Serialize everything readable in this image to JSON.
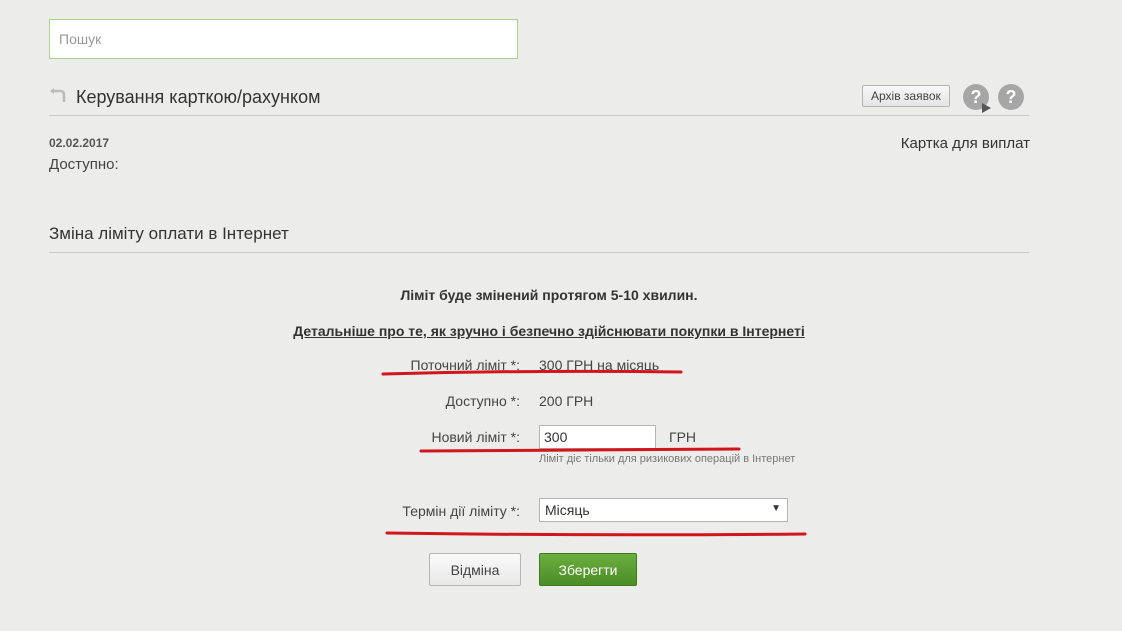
{
  "search": {
    "placeholder": "Пошук"
  },
  "header": {
    "title": "Керування карткою/рахунком",
    "archive_label": "Архів заявок"
  },
  "account": {
    "date": "02.02.2017",
    "available_label": "Доступно:",
    "card_type": "Картка для виплат"
  },
  "section": {
    "title": "Зміна ліміту оплати в Інтернет",
    "notice": "Ліміт буде змінений протягом 5-10 хвилин.",
    "details_link": "Детальніше про те, як зручно і безпечно здійснювати покупки в Інтернеті"
  },
  "form": {
    "current_limit_label": "Поточний ліміт *:",
    "current_limit_value": "300 ГРН на місяць",
    "available_label": "Доступно *:",
    "available_value": "200 ГРН",
    "new_limit_label": "Новий ліміт *:",
    "new_limit_value": "300",
    "currency": "ГРН",
    "hint": "Ліміт діє тільки для ризикових операцій в Інтернет",
    "term_label": "Термін дії ліміту *:",
    "term_value": "Місяць",
    "cancel_label": "Відміна",
    "save_label": "Зберегти"
  },
  "colors": {
    "accent_green": "#4b8d26",
    "annotation_red": "#d0161b",
    "search_border": "#a9d18e"
  }
}
